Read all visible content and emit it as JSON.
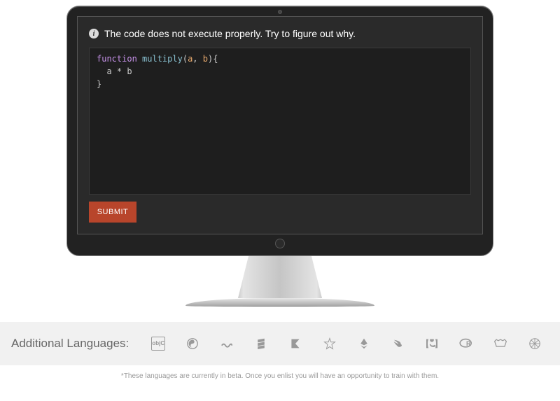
{
  "prompt": "The code does not execute properly. Try to figure out why.",
  "code": {
    "line1": {
      "kw": "function",
      "fn": "multiply",
      "paren_open": "(",
      "arg1": "a",
      "comma": ", ",
      "arg2": "b",
      "paren_close": ")",
      "brace_open": "{"
    },
    "line2": "  a * b",
    "line3": "}"
  },
  "submit_label": "SUBMIT",
  "lang_section": {
    "title": "Additional Languages:",
    "footnote": "*These languages are currently in beta. Once you enlist you will have an opportunity to train with them."
  },
  "lang_icons": {
    "objc": "objC"
  }
}
